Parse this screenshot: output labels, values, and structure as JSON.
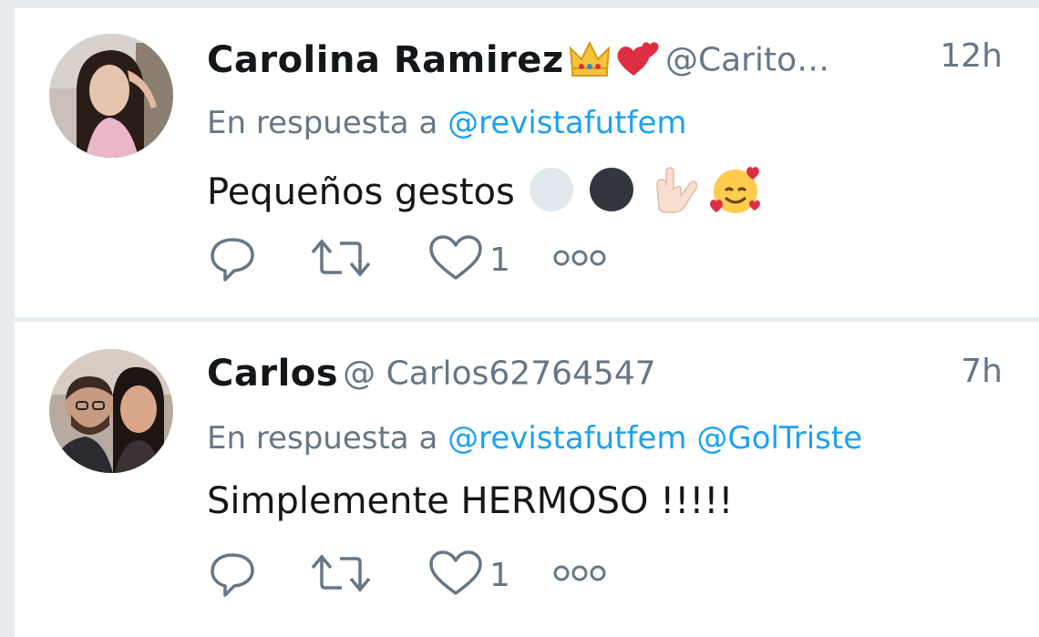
{
  "tweets": [
    {
      "name": "Carolina Ramirez",
      "name_emojis": [
        "crown-emoji",
        "two-hearts-emoji"
      ],
      "handle": "@Carito…",
      "time": "12h",
      "reply_prefix": "En respuesta a",
      "mentions": [
        "@revistafutfem"
      ],
      "text": "Pequeños gestos",
      "text_emojis": [
        "white-circle-emoji",
        "black-circle-emoji",
        "love-you-gesture-emoji",
        "smiling-face-with-hearts-emoji"
      ],
      "like_count": "1"
    },
    {
      "name": "Carlos",
      "handle": "@ Carlos62764547",
      "time": "7h",
      "reply_prefix": "En respuesta a",
      "mentions": [
        "@revistafutfem",
        "@GolTriste"
      ],
      "text": "Simplemente HERMOSO !!!!!",
      "like_count": "1"
    }
  ],
  "colors": {
    "background": "#ffffff",
    "separator": "#e6ecf0",
    "name": "#14171a",
    "secondary": "#657786",
    "link": "#1da1f2"
  },
  "icons": [
    "reply-icon",
    "retweet-icon",
    "like-icon",
    "more-icon"
  ]
}
